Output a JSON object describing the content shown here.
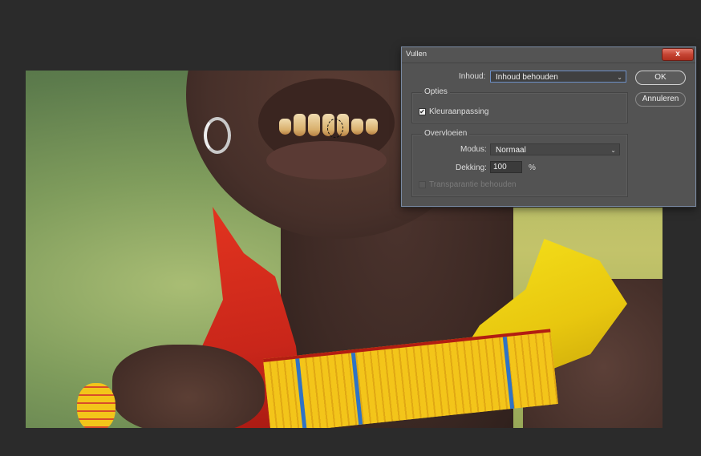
{
  "dialog": {
    "title": "Vullen",
    "close_glyph": "x",
    "inhoud_label": "Inhoud:",
    "inhoud_value": "Inhoud behouden",
    "ok_label": "OK",
    "cancel_label": "Annuleren",
    "options_group": {
      "title": "Opties",
      "color_adapt_label": "Kleuraanpassing",
      "color_adapt_checked": true
    },
    "blend_group": {
      "title": "Overvloeien",
      "mode_label": "Modus:",
      "mode_value": "Normaal",
      "opacity_label": "Dekking:",
      "opacity_value": "100",
      "opacity_unit": "%",
      "preserve_transparency_label": "Transparantie behouden",
      "preserve_transparency_checked": false,
      "preserve_transparency_enabled": false
    }
  },
  "icons": {
    "dropdown": "chevron-down-icon",
    "check": "checkmark-icon",
    "close": "close-icon"
  }
}
